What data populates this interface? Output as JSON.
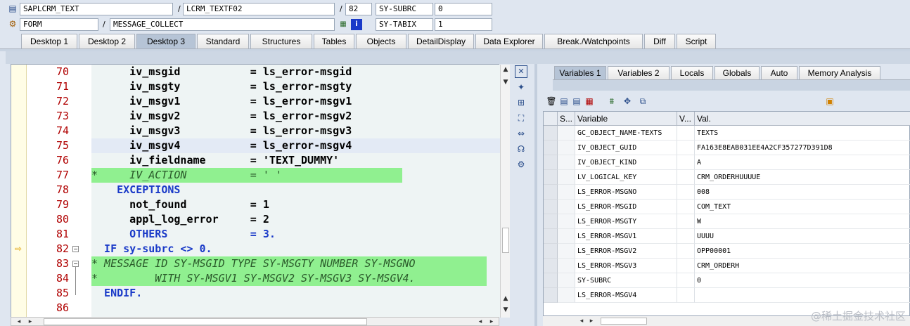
{
  "header": {
    "row1": {
      "program": "SAPLCRM_TEXT",
      "include": "LCRM_TEXTF02",
      "line": "82",
      "var_name": "SY-SUBRC",
      "var_value": "0"
    },
    "row2": {
      "type": "FORM",
      "name": "MESSAGE_COLLECT",
      "var_name": "SY-TABIX",
      "var_value": "1"
    },
    "slash": "/"
  },
  "tabs": [
    {
      "label": "Desktop 1"
    },
    {
      "label": "Desktop 2"
    },
    {
      "label": "Desktop 3",
      "active": true
    },
    {
      "label": "Standard"
    },
    {
      "label": "Structures"
    },
    {
      "label": "Tables"
    },
    {
      "label": "Objects"
    },
    {
      "label": "DetailDisplay"
    },
    {
      "label": "Data Explorer"
    },
    {
      "label": "Break./Watchpoints"
    },
    {
      "label": "Diff"
    },
    {
      "label": "Script"
    }
  ],
  "code_lines": [
    {
      "num": "70",
      "text": "      iv_msgid           = ls_error-msgid"
    },
    {
      "num": "71",
      "text": "      iv_msgty           = ls_error-msgty"
    },
    {
      "num": "72",
      "text": "      iv_msgv1           = ls_error-msgv1"
    },
    {
      "num": "73",
      "text": "      iv_msgv2           = ls_error-msgv2"
    },
    {
      "num": "74",
      "text": "      iv_msgv3           = ls_error-msgv3"
    },
    {
      "num": "75",
      "text": "      iv_msgv4           = ls_error-msgv4"
    },
    {
      "num": "76",
      "text": "      iv_fieldname       = 'TEXT_DUMMY'"
    },
    {
      "num": "77",
      "text": "*     IV_ACTION          = ' '"
    },
    {
      "num": "78",
      "text": "    EXCEPTIONS"
    },
    {
      "num": "79",
      "text": "      not_found          = 1"
    },
    {
      "num": "80",
      "text": "      appl_log_error     = 2"
    },
    {
      "num": "81",
      "text": "      OTHERS             = 3."
    },
    {
      "num": "82",
      "text": "  IF sy-subrc <> 0."
    },
    {
      "num": "83",
      "text": "* MESSAGE ID SY-MSGID TYPE SY-MSGTY NUMBER SY-MSGNO"
    },
    {
      "num": "84",
      "text": "*         WITH SY-MSGV1 SY-MSGV2 SY-MSGV3 SY-MSGV4."
    },
    {
      "num": "85",
      "text": "  ENDIF."
    },
    {
      "num": "86",
      "text": ""
    }
  ],
  "right_tabs": [
    {
      "label": "Variables 1",
      "active": true
    },
    {
      "label": "Variables 2"
    },
    {
      "label": "Locals"
    },
    {
      "label": "Globals"
    },
    {
      "label": "Auto"
    },
    {
      "label": "Memory Analysis"
    }
  ],
  "grid": {
    "headers": {
      "s": "S...",
      "variable": "Variable",
      "v": "V...",
      "val": "Val."
    },
    "rows": [
      {
        "variable": "GC_OBJECT_NAME-TEXTS",
        "value": "TEXTS"
      },
      {
        "variable": "IV_OBJECT_GUID",
        "value": "FA163E8EAB031EE4A2CF357277D391D8"
      },
      {
        "variable": "IV_OBJECT_KIND",
        "value": "A"
      },
      {
        "variable": "LV_LOGICAL_KEY",
        "value": "CRM_ORDERHUUUUE"
      },
      {
        "variable": "LS_ERROR-MSGNO",
        "value": "008"
      },
      {
        "variable": "LS_ERROR-MSGID",
        "value": "COM_TEXT"
      },
      {
        "variable": "LS_ERROR-MSGTY",
        "value": "W"
      },
      {
        "variable": "LS_ERROR-MSGV1",
        "value": "UUUU"
      },
      {
        "variable": "LS_ERROR-MSGV2",
        "value": "OPP00001"
      },
      {
        "variable": "LS_ERROR-MSGV3",
        "value": "CRM_ORDERH"
      },
      {
        "variable": "SY-SUBRC",
        "value": "0"
      },
      {
        "variable": "LS_ERROR-MSGV4",
        "value": ""
      }
    ]
  },
  "watermark": "@稀土掘金技术社区"
}
